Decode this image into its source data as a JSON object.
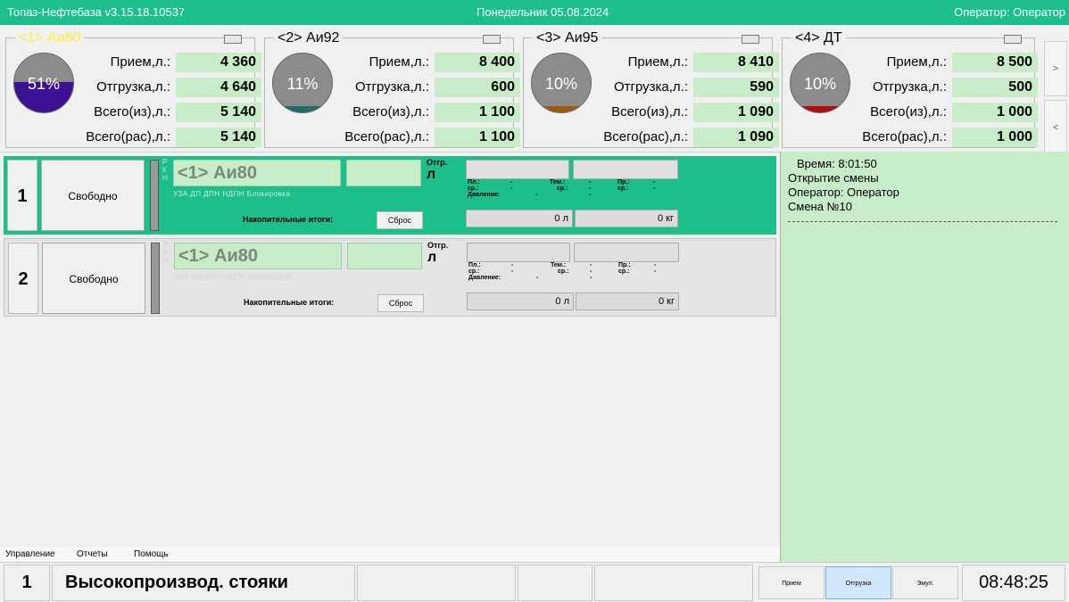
{
  "app": {
    "title": "Топаз-Нефтебаза  v3.15.18.10537",
    "date": "Понедельник 05.08.2024",
    "operator": "Оператор: Оператор"
  },
  "tanks": [
    {
      "name": "<1> Аи80",
      "percent": "51%",
      "level": 0.51,
      "fill_color": "#3d1193",
      "rows": [
        {
          "label": "Прием,л.:",
          "value": "4 360"
        },
        {
          "label": "Отгрузка,л.:",
          "value": "4 640"
        },
        {
          "label": "Всего(из),л.:",
          "value": "5 140"
        },
        {
          "label": "Всего(рас),л.:",
          "value": "5 140"
        }
      ]
    },
    {
      "name": "<2> Аи92",
      "percent": "11%",
      "level": 0.11,
      "fill_color": "#1e6b6b",
      "rows": [
        {
          "label": "Прием,л.:",
          "value": "8 400"
        },
        {
          "label": "Отгрузка,л.:",
          "value": "600"
        },
        {
          "label": "Всего(из),л.:",
          "value": "1 100"
        },
        {
          "label": "Всего(рас),л.:",
          "value": "1 100"
        }
      ]
    },
    {
      "name": "<3> Аи95",
      "percent": "10%",
      "level": 0.1,
      "fill_color": "#9a5b12",
      "rows": [
        {
          "label": "Прием,л.:",
          "value": "8 410"
        },
        {
          "label": "Отгрузка,л.:",
          "value": "590"
        },
        {
          "label": "Всего(из),л.:",
          "value": "1 090"
        },
        {
          "label": "Всего(рас),л.:",
          "value": "1 090"
        }
      ]
    },
    {
      "name": "<4> ДТ",
      "percent": "10%",
      "level": 0.1,
      "fill_color": "#b40d0d",
      "rows": [
        {
          "label": "Прием,л.:",
          "value": "8 500"
        },
        {
          "label": "Отгрузка,л.:",
          "value": "500"
        },
        {
          "label": "Всего(из),л.:",
          "value": "1 000"
        },
        {
          "label": "Всего(рас),л.:",
          "value": "1 000"
        }
      ]
    }
  ],
  "nav": {
    "next": ">",
    "prev": "<"
  },
  "posts": [
    {
      "num": "1",
      "state": "Свободно",
      "fuel": "<1> Аи80",
      "rkn": "Р К Н",
      "modes": "УЗА   ДП   ДПН   НДПН   Блокировка",
      "totals_label": "Накопительные итоги:",
      "reset": "Сброс",
      "op": "Отгр.",
      "unit": "л",
      "params": {
        "pl": "Пл.:",
        "pl_sr": "ср.:",
        "pressure": "Давление:",
        "tem": "Тем.:",
        "tem_sr": "ср.:",
        "pr": "Пр.:",
        "pr_sr": "ср.:",
        "dash": "-"
      },
      "counter_l": "0 л",
      "counter_kg": "0 кг"
    },
    {
      "num": "2",
      "state": "Свободно",
      "fuel": "<1> Аи80",
      "rkn": "Р К Н",
      "modes": "УЗА   ДП   ДПН   НДПН   Блокировка",
      "totals_label": "Накопительные итоги:",
      "reset": "Сброс",
      "op": "Отгр.",
      "unit": "л",
      "params": {
        "pl": "Пл.:",
        "pl_sr": "ср.:",
        "pressure": "Давление:",
        "tem": "Тем.:",
        "tem_sr": "ср.:",
        "pr": "Пр.:",
        "pr_sr": "ср.:",
        "dash": "-"
      },
      "counter_l": "0 л",
      "counter_kg": "0 кг"
    }
  ],
  "log": {
    "time": "Время: 8:01:50",
    "event": "Открытие смены",
    "operator": "Оператор: Оператор",
    "shift": "Смена №10"
  },
  "menu": [
    "Управление",
    "Отчеты",
    "Помощь"
  ],
  "status": {
    "num": "1",
    "title": "Высокопроизвод. стояки",
    "modes": [
      "Прием",
      "Отгрузка",
      "Эмул."
    ],
    "clock": "08:48:25"
  }
}
